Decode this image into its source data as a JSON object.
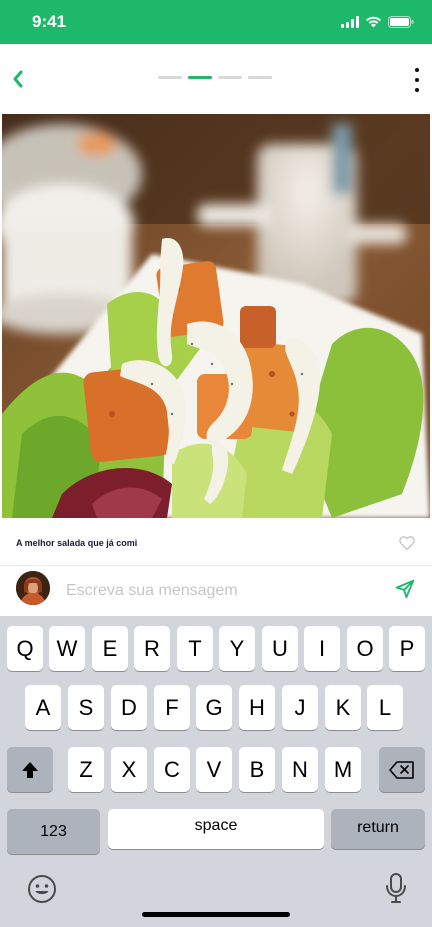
{
  "status_bar": {
    "time": "9:41"
  },
  "header": {
    "back_icon": "chevron-left-icon",
    "more_icon": "more-vertical-icon",
    "pages": 4,
    "active_page": 2
  },
  "post": {
    "image_alt": "salada com croutons",
    "caption": "A melhor salada que já comi",
    "like_icon": "heart-icon"
  },
  "comment": {
    "placeholder": "Escreva sua mensagem",
    "send_icon": "send-icon"
  },
  "keyboard": {
    "row1": [
      "Q",
      "W",
      "E",
      "R",
      "T",
      "Y",
      "U",
      "I",
      "O",
      "P"
    ],
    "row2": [
      "A",
      "S",
      "D",
      "F",
      "G",
      "H",
      "J",
      "K",
      "L"
    ],
    "row3": [
      "Z",
      "X",
      "C",
      "V",
      "B",
      "N",
      "M"
    ],
    "numbers_label": "123",
    "space_label": "space",
    "return_label": "return"
  },
  "colors": {
    "accent": "#1db86a",
    "keyboard_bg": "#d2d5db",
    "key": "#ffffff",
    "dark_key": "#adb3bc"
  }
}
